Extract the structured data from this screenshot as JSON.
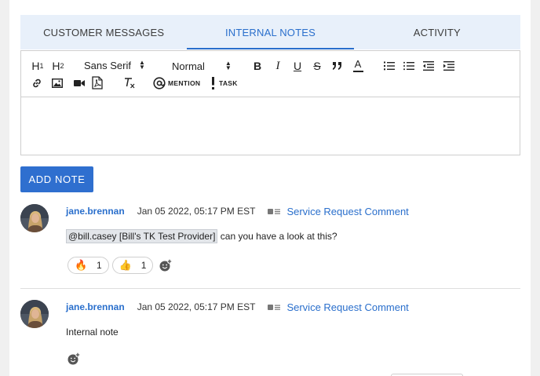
{
  "tabs": [
    {
      "label": "CUSTOMER MESSAGES",
      "active": false
    },
    {
      "label": "INTERNAL NOTES",
      "active": true
    },
    {
      "label": "ACTIVITY",
      "active": false
    }
  ],
  "toolbar": {
    "h1": "H1",
    "h2": "H2",
    "font_value": "Sans Serif",
    "size_value": "Normal",
    "bold": "B",
    "italic": "I",
    "underline": "U",
    "strike": "S",
    "quote": "99",
    "color_letter": "A",
    "mention_label": "MENTION",
    "task_label": "TASK",
    "icons": [
      "link-icon",
      "image-icon",
      "video-icon",
      "pdf-icon",
      "clear-format-icon",
      "mention-icon",
      "task-icon",
      "ordered-list-icon",
      "bullet-list-icon",
      "outdent-icon",
      "indent-icon"
    ]
  },
  "editor": {
    "value": ""
  },
  "add_note_label": "ADD NOTE",
  "notes": [
    {
      "author": "jane.brennan",
      "date": "Jan 05 2022, 05:17 PM EST",
      "type": "Service Request Comment",
      "mention": "@bill.casey [Bill's TK Test Provider]",
      "text": " can you have a look at this?",
      "reactions": [
        {
          "emoji": "🔥",
          "count": "1"
        },
        {
          "emoji": "👍",
          "count": "1"
        }
      ]
    },
    {
      "author": "jane.brennan",
      "date": "Jan 05 2022, 05:17 PM EST",
      "type": "Service Request Comment",
      "text": "Internal note",
      "reactions": []
    }
  ],
  "colors": {
    "accent": "#2a6fcc",
    "button": "#2f6fcf",
    "tab_bg": "#e8f0fa"
  }
}
